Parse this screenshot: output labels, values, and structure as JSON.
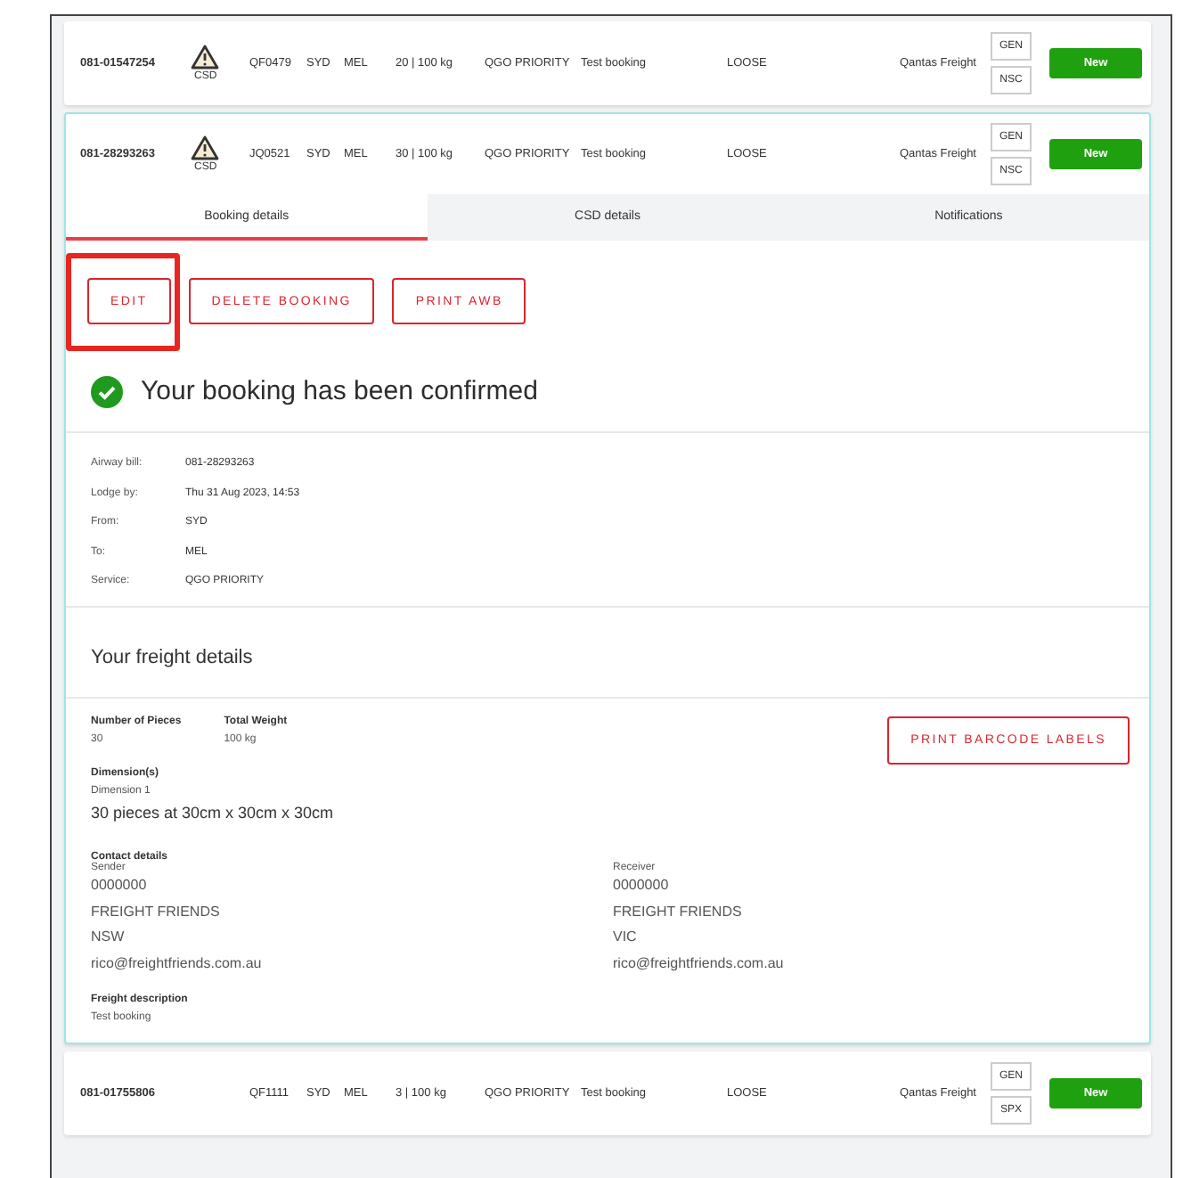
{
  "bookings": [
    {
      "awb": "081-01547254",
      "csd": true,
      "csd_label": "CSD",
      "flight": "QF0479",
      "from": "SYD",
      "to": "MEL",
      "pieces_weight": "20 | 100 kg",
      "service": "QGO PRIORITY",
      "description": "Test booking",
      "type": "LOOSE",
      "carrier": "Qantas Freight",
      "tags": [
        "GEN",
        "NSC"
      ],
      "status": "New",
      "expanded": false
    },
    {
      "awb": "081-28293263",
      "csd": true,
      "csd_label": "CSD",
      "flight": "JQ0521",
      "from": "SYD",
      "to": "MEL",
      "pieces_weight": "30 | 100 kg",
      "service": "QGO PRIORITY",
      "description": "Test booking",
      "type": "LOOSE",
      "carrier": "Qantas Freight",
      "tags": [
        "GEN",
        "NSC"
      ],
      "status": "New",
      "expanded": true,
      "details": {
        "tabs": [
          {
            "label": "Booking details",
            "selected": true
          },
          {
            "label": "CSD details",
            "selected": false
          },
          {
            "label": "Notifications",
            "selected": false
          }
        ],
        "actions": [
          {
            "label": "EDIT",
            "highlighted": true
          },
          {
            "label": "DELETE BOOKING",
            "highlighted": false
          },
          {
            "label": "PRINT AWB",
            "highlighted": false
          }
        ],
        "confirmation": "Your booking has been confirmed",
        "info": [
          {
            "label": "Airway bill:",
            "value": "081-28293263"
          },
          {
            "label": "Lodge by:",
            "value": "Thu 31 Aug 2023, 14:53"
          },
          {
            "label": "From:",
            "value": "SYD"
          },
          {
            "label": "To:",
            "value": "MEL"
          },
          {
            "label": "Service:",
            "value": "QGO PRIORITY"
          }
        ],
        "freight_heading": "Your freight details",
        "pieces": {
          "label": "Number of Pieces",
          "value": "30"
        },
        "weight": {
          "label": "Total Weight",
          "value": "100 kg"
        },
        "barcode_button": "PRINT BARCODE LABELS",
        "dimensions_label": "Dimension(s)",
        "dimension_name": "Dimension 1",
        "dimension_value": "30 pieces at 30cm x 30cm x 30cm",
        "contact_label": "Contact details",
        "sender": {
          "label": "Sender",
          "lines": [
            "0000000",
            "FREIGHT FRIENDS",
            "NSW",
            "rico@freightfriends.com.au"
          ]
        },
        "receiver": {
          "label": "Receiver",
          "lines": [
            "0000000",
            "FREIGHT FRIENDS",
            "VIC",
            "rico@freightfriends.com.au"
          ]
        },
        "description_label": "Freight description",
        "description_value": "Test booking"
      }
    },
    {
      "awb": "081-01755806",
      "csd": false,
      "flight": "QF1111",
      "from": "SYD",
      "to": "MEL",
      "pieces_weight": "3 | 100 kg",
      "service": "QGO PRIORITY",
      "description": "Test booking",
      "type": "LOOSE",
      "carrier": "Qantas Freight",
      "tags": [
        "GEN",
        "SPX"
      ],
      "status": "New",
      "expanded": false
    }
  ]
}
